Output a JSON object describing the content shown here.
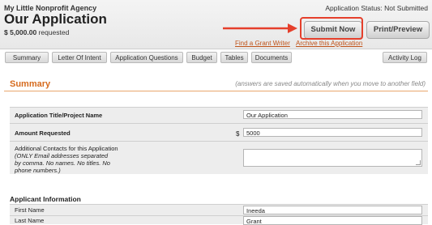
{
  "header": {
    "org_name": "My Little Nonprofit Agency",
    "title": "Our Application",
    "amount": "$ 5,000.00",
    "amount_suffix": " requested",
    "status": "Application Status: Not Submitted",
    "submit_label": "Submit Now",
    "print_label": "Print/Preview",
    "link_grant_writer": "Find a Grant Writer",
    "link_archive": "Archive this Application"
  },
  "tabs": [
    {
      "label": "Summary"
    },
    {
      "label": "Letter Of Intent"
    },
    {
      "label": "Application Questions"
    },
    {
      "label": "Budget"
    },
    {
      "label": "Tables"
    },
    {
      "label": "Documents"
    },
    {
      "label": "Activity Log"
    }
  ],
  "summary": {
    "title": "Summary",
    "autosave_note": "(answers are saved automatically when you move to another field)"
  },
  "form": {
    "project_name_label": "Application Title/Project Name",
    "project_name_value": "Our Application",
    "amount_label": "Amount Requested",
    "currency": "$",
    "amount_value": "5000",
    "contacts_label": "Additional Contacts for this Application",
    "contacts_note": "(ONLY Email addresses separated by comma. No names. No titles. No phone numbers.)",
    "contacts_value": ""
  },
  "applicant": {
    "title": "Applicant Information",
    "first_name_label": "First Name",
    "first_name_value": "Ineeda",
    "last_name_label": "Last Name",
    "last_name_value": "Grant"
  },
  "colors": {
    "accent": "#d66b1e",
    "highlight": "#e53f2b"
  }
}
